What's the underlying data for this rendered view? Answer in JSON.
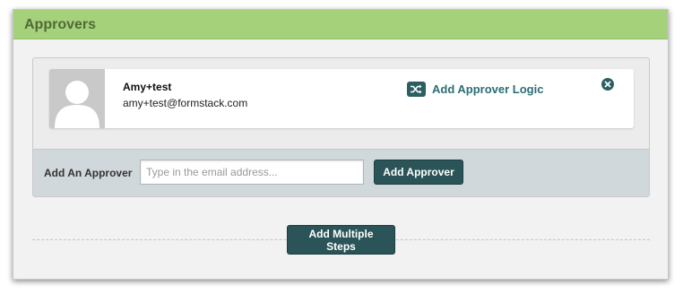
{
  "panel": {
    "title": "Approvers"
  },
  "approver": {
    "name": "Amy+test",
    "email": "amy+test@formstack.com",
    "avatar_icon": "default-user-avatar",
    "logic_link_label": "Add Approver Logic",
    "logic_icon": "shuffle-icon",
    "remove_icon": "close-circle-icon"
  },
  "add_approver": {
    "label": "Add An Approver",
    "placeholder": "Type in the email address...",
    "value": "",
    "button_label": "Add Approver"
  },
  "footer": {
    "multiple_steps_label": "Add Multiple Steps"
  },
  "colors": {
    "header_green": "#a6d17b",
    "header_text": "#4f6a37",
    "button_teal": "#2a5458",
    "link_teal": "#2a6e74"
  }
}
